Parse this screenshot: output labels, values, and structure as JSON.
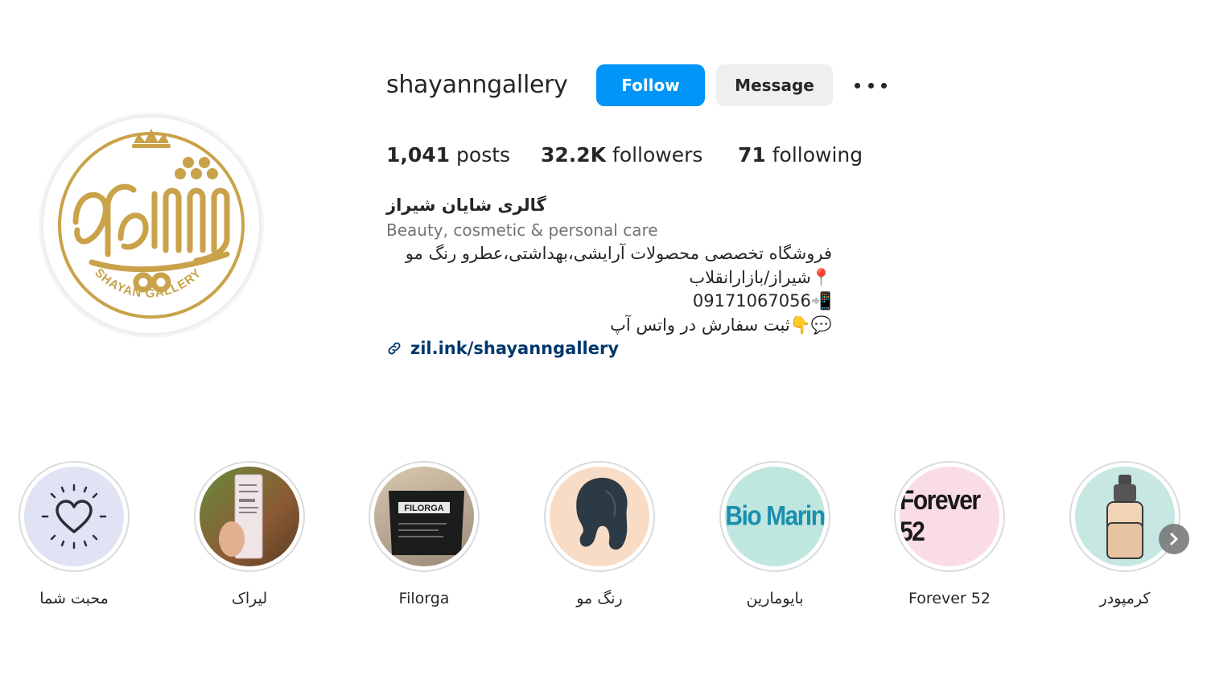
{
  "profile": {
    "username": "shayanngallery",
    "follow_label": "Follow",
    "message_label": "Message",
    "more_icon": "more-options-icon",
    "avatar_brand": "SHAYAN GALLERY",
    "stats": {
      "posts_count": "1,041",
      "posts_label": "posts",
      "followers_count": "32.2K",
      "followers_label": "followers",
      "following_count": "71",
      "following_label": "following"
    },
    "full_name": "گالری شایان شیراز",
    "category": "Beauty, cosmetic & personal care",
    "bio": [
      "فروشگاه تخصصی محصولات آرایشی،بهداشتی،عطرو رنگ مو",
      "📍شیراز/بازارانقلاب",
      "📲09171067056",
      "💬👇ثبت سفارش در واتس آپ"
    ],
    "link": "zil.ink/shayanngallery"
  },
  "highlights": [
    {
      "label": "محبت شما",
      "bg": "#dfe3f3"
    },
    {
      "label": "لیراک",
      "bg": "#7a5a3c"
    },
    {
      "label": "Filorga",
      "bg": "#c9b89f"
    },
    {
      "label": "رنگ مو",
      "bg": "#f9dcc6"
    },
    {
      "label": "بایومارین",
      "bg": "#bfe6df",
      "text": "Bio Marin",
      "text_color": "#1b8fb0"
    },
    {
      "label": "Forever 52",
      "bg": "#fadce6",
      "text": "Forever 52",
      "text_color": "#1a1a1a"
    },
    {
      "label": "کرمپودر",
      "bg": "#c7e7e2"
    }
  ],
  "colors": {
    "accent": "#0095f6",
    "gold": "#c9a24a",
    "link": "#00376b"
  }
}
